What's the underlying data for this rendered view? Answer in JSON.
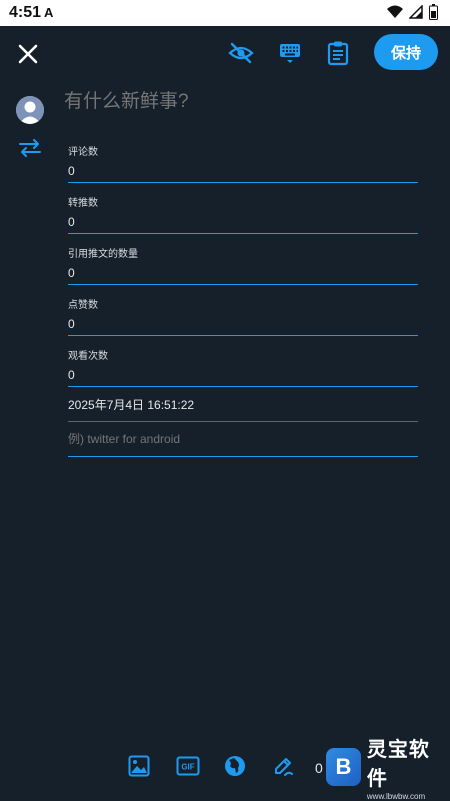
{
  "status_bar": {
    "time": "4:51",
    "app_glyph": "A"
  },
  "topbar": {
    "save_label": "保持"
  },
  "compose": {
    "placeholder": "有什么新鲜事?"
  },
  "fields": [
    {
      "label": "评论数",
      "value": "0"
    },
    {
      "label": "转推数",
      "value": "0"
    },
    {
      "label": "引用推文的数量",
      "value": "0"
    },
    {
      "label": "点赞数",
      "value": "0"
    },
    {
      "label": "观看次数",
      "value": "0"
    }
  ],
  "datetime": "2025年7月4日 16:51:22",
  "via": {
    "placeholder": "例) twitter for android"
  },
  "toolbar": {
    "counter": "0"
  },
  "watermark": {
    "logo_glyph": "B",
    "title": "灵宝软件",
    "url": "www.lbwbw.com"
  },
  "colors": {
    "accent": "#1d9bf0",
    "background": "#15202b"
  },
  "icons": [
    "close-icon",
    "hide-icon",
    "keyboard-icon",
    "clipboard-icon",
    "avatar",
    "retweet-icon",
    "image-icon",
    "gif-icon",
    "globe-icon",
    "draw-icon"
  ]
}
